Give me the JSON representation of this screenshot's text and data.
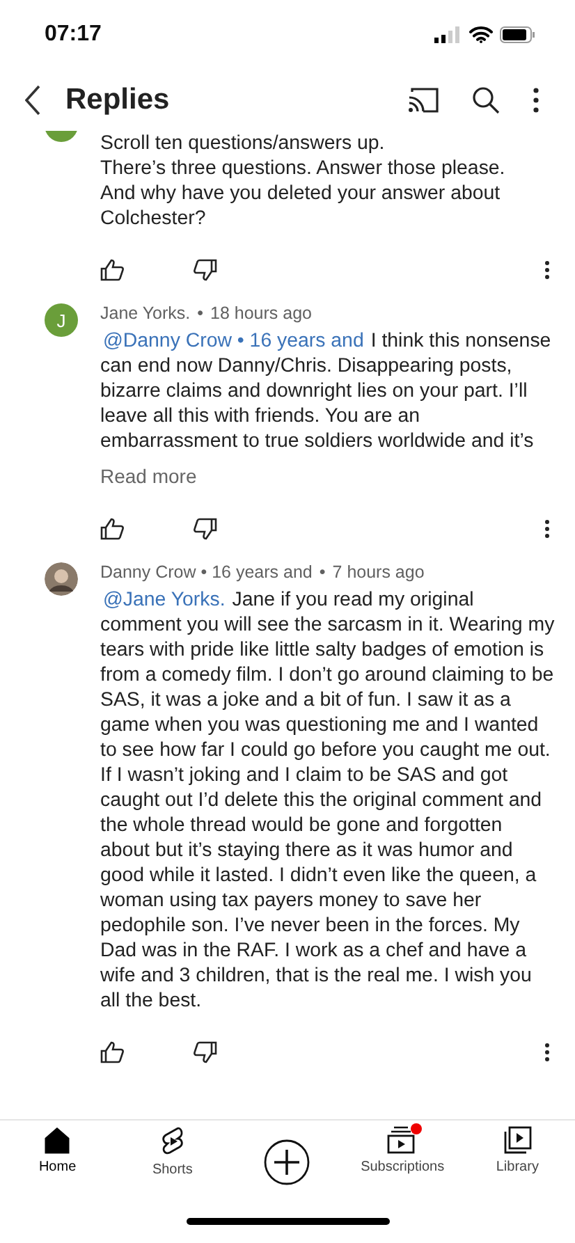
{
  "status_bar": {
    "time": "07:17"
  },
  "header": {
    "title": "Replies"
  },
  "comments": [
    {
      "avatar": {
        "kind": "letter"
      },
      "body": "Scroll ten questions/answers up.\nThere’s three questions. Answer those please.\nAnd why have you deleted your answer about Colchester?"
    },
    {
      "avatar": {
        "kind": "letter",
        "letter": "J"
      },
      "author": "Jane Yorks.",
      "separator": "•",
      "time": "18 hours ago",
      "mention": "@Danny Crow • 16 years and",
      "body": "I think this nonsense can end now Danny/Chris. Disappearing posts, bizarre claims and downright lies on your part. I’ll leave all this with friends. You are an embarrassment to true soldiers worldwide and it’s",
      "read_more": "Read more"
    },
    {
      "avatar": {
        "kind": "photo"
      },
      "author": "Danny Crow • 16 years and",
      "separator": "•",
      "time": "7 hours ago",
      "mention": "@Jane Yorks.",
      "body": "Jane if you read my original comment you will see the sarcasm in it. Wearing my tears with pride like little salty badges of emotion is from a comedy film. I don’t go around claiming to be SAS, it was a joke and a bit of fun. I saw it as a game when you was questioning me and I wanted to see how far I could go before you caught me out. If I wasn’t joking and I claim to be SAS and got caught out I’d delete this the original comment and the whole thread would be gone and forgotten about but it’s staying there as it was humor and good while it lasted. I didn’t even like the queen, a woman using tax payers money to save her pedophile son. I’ve never been in the forces. My Dad was in the RAF. I work as a chef and have a wife and 3 children, that is the real me. I wish you all the best."
    }
  ],
  "tabs": [
    {
      "kind": "home",
      "label": "Home",
      "selected": true
    },
    {
      "kind": "shorts",
      "label": "Shorts",
      "selected": false
    },
    {
      "kind": "create",
      "selected": false
    },
    {
      "kind": "subscriptions",
      "label": "Subscriptions",
      "selected": false,
      "badge": true
    },
    {
      "kind": "library",
      "label": "Library",
      "selected": false
    }
  ]
}
